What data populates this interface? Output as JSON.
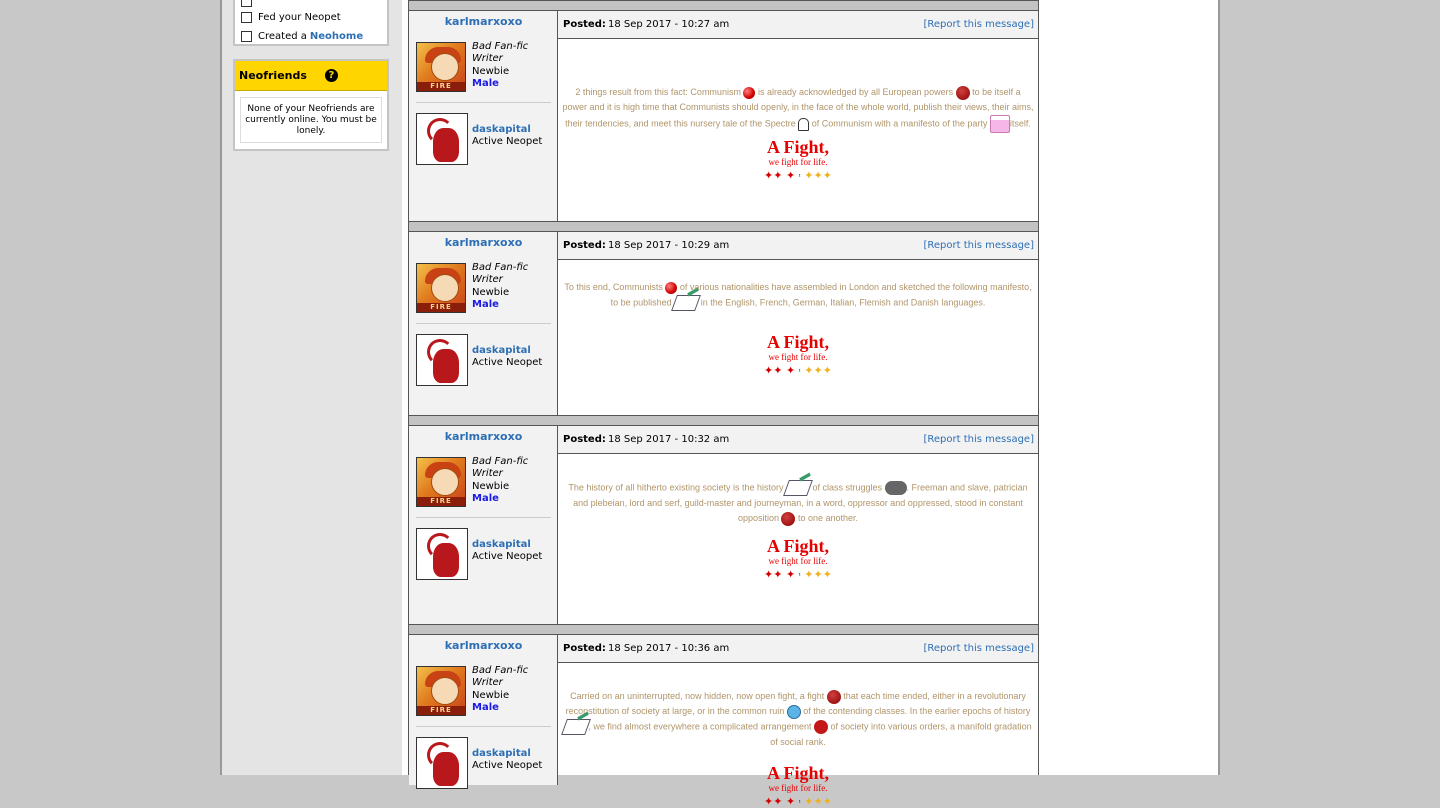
{
  "sidebar": {
    "checklist": [
      {
        "label": "Fed your Neopet",
        "link": ""
      },
      {
        "label": "Created a ",
        "link": "Neohome"
      }
    ],
    "neofriends": {
      "title": "Neofriends",
      "help_icon": "?",
      "message": "None of your Neofriends are currently online. You must be lonely."
    }
  },
  "labels": {
    "posted": "Posted:",
    "report": "Report this message",
    "report_open": "[",
    "report_close": "]",
    "fire_badge": "FIRE"
  },
  "signature": {
    "title": "A Fight,",
    "subtitle": "we fight for life.",
    "stars_left": "✦✦ ✦",
    "stars_mid": "ᶦ",
    "stars_right": "✦✦✦"
  },
  "posts": [
    {
      "author": {
        "username": "karlmarxoxo",
        "title": "Bad Fan-fic Writer",
        "status": "Newbie",
        "gender": "Male",
        "pet_name": "daskapital",
        "pet_status": "Active Neopet"
      },
      "date": "18 Sep 2017 - 10:27 am",
      "segments": [
        "2 things result from this fact: Communism ",
        " is already acknowledged by all European powers ",
        " to be itself a power and it is high time that Communists should openly, in the face of the whole world, publish their views, their aims, their tendencies, and meet this nursery tale of the Spectre ",
        " of Communism with a manifesto of the party ",
        "itself."
      ],
      "emoticons": [
        "red-ball",
        "angry-face",
        "ghost",
        "cake"
      ]
    },
    {
      "author": {
        "username": "karlmarxoxo",
        "title": "Bad Fan-fic Writer",
        "status": "Newbie",
        "gender": "Male",
        "pet_name": "daskapital",
        "pet_status": "Active Neopet"
      },
      "date": "18 Sep 2017 - 10:29 am",
      "segments": [
        "To this end, Communists ",
        " of various nationalities have assembled in London and sketched the following manifesto, to be published ",
        " in the English, French, German, Italian, Flemish and Danish languages."
      ],
      "emoticons": [
        "red-ball",
        "book-quill"
      ]
    },
    {
      "author": {
        "username": "karlmarxoxo",
        "title": "Bad Fan-fic Writer",
        "status": "Newbie",
        "gender": "Male",
        "pet_name": "daskapital",
        "pet_status": "Active Neopet"
      },
      "date": "18 Sep 2017 - 10:32 am",
      "segments": [
        "The history of all hitherto existing society is the history ",
        " of class struggles ",
        ". Freeman and slave, patrician and plebeian, lord and serf, guild-master and journeyman, in a word, oppressor and oppressed, stood in constant opposition ",
        " to one another."
      ],
      "emoticons": [
        "book-quill",
        "storm-cloud",
        "angry-face"
      ]
    },
    {
      "author": {
        "username": "karlmarxoxo",
        "title": "Bad Fan-fic Writer",
        "status": "Newbie",
        "gender": "Male",
        "pet_name": "daskapital",
        "pet_status": "Active Neopet"
      },
      "date": "18 Sep 2017 - 10:36 am",
      "segments": [
        "Carried on an uninterrupted, now hidden, now open fight, a fight ",
        " that each time ended, either in a revolutionary reconstitution of society at large, or in the common ruin ",
        " of the contending classes. In the earlier epochs of history ",
        ", we find almost everywhere a complicated arrangement ",
        " of society into various orders, a manifold gradation of social rank."
      ],
      "emoticons": [
        "angry-face",
        "sad-face",
        "book-quill",
        "rose"
      ]
    }
  ]
}
